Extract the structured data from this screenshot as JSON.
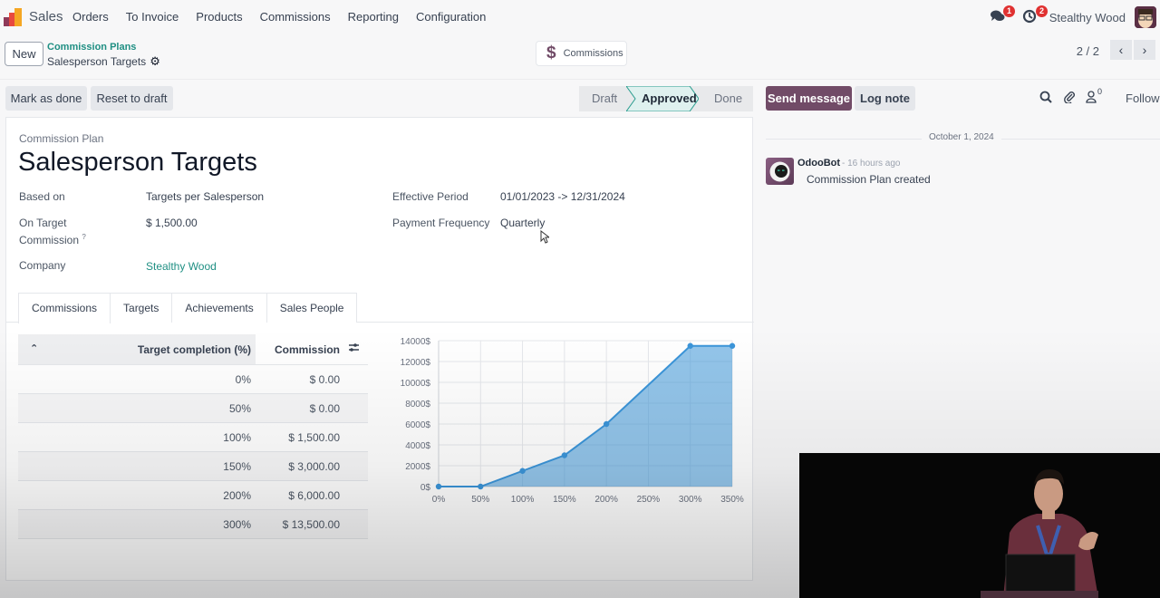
{
  "navbar": {
    "app_name": "Sales",
    "menu": [
      "Orders",
      "To Invoice",
      "Products",
      "Commissions",
      "Reporting",
      "Configuration"
    ],
    "messages_badge": "1",
    "activities_badge": "2",
    "user_name": "Stealthy Wood"
  },
  "control_panel": {
    "new_label": "New",
    "breadcrumb_parent": "Commission Plans",
    "breadcrumb_current": "Salesperson Targets",
    "smart_button_label": "Commissions",
    "pager": "2 / 2"
  },
  "statusbar": {
    "buttons": [
      "Mark as done",
      "Reset to draft"
    ],
    "stages": [
      "Draft",
      "Approved",
      "Done"
    ],
    "active_stage": "Approved"
  },
  "form": {
    "model_label": "Commission Plan",
    "title": "Salesperson Targets",
    "fields": {
      "based_on": {
        "label": "Based on",
        "value": "Targets per Salesperson"
      },
      "on_target_commission": {
        "label_line1": "On Target",
        "label_line2": "Commission",
        "help": "?",
        "value": "$ 1,500.00"
      },
      "company": {
        "label": "Company",
        "value": "Stealthy Wood"
      },
      "effective_period": {
        "label": "Effective Period",
        "value": "01/01/2023 -> 12/31/2024"
      },
      "payment_frequency": {
        "label": "Payment Frequency",
        "value": "Quarterly"
      }
    },
    "tabs": [
      "Commissions",
      "Targets",
      "Achievements",
      "Sales People"
    ],
    "active_tab": "Commissions"
  },
  "commission_table": {
    "headers": [
      "Target completion (%)",
      "Commission"
    ],
    "rows": [
      {
        "target": "0%",
        "commission": "$ 0.00"
      },
      {
        "target": "50%",
        "commission": "$ 0.00"
      },
      {
        "target": "100%",
        "commission": "$ 1,500.00"
      },
      {
        "target": "150%",
        "commission": "$ 3,000.00"
      },
      {
        "target": "200%",
        "commission": "$ 6,000.00"
      },
      {
        "target": "300%",
        "commission": "$ 13,500.00"
      }
    ]
  },
  "chart_data": {
    "type": "area",
    "title": "",
    "xlabel": "",
    "ylabel": "",
    "x_ticks": [
      "0%",
      "50%",
      "100%",
      "150%",
      "200%",
      "250%",
      "300%",
      "350%"
    ],
    "y_ticks": [
      "0$",
      "2000$",
      "4000$",
      "6000$",
      "8000$",
      "10000$",
      "12000$",
      "14000$"
    ],
    "xlim": [
      0,
      350
    ],
    "ylim": [
      0,
      14000
    ],
    "grid": true,
    "legend": "none",
    "series": [
      {
        "name": "Commission",
        "color": "#3b95d9",
        "x": [
          0,
          50,
          100,
          150,
          200,
          300,
          350
        ],
        "y": [
          0,
          0,
          1500,
          3000,
          6000,
          13500,
          13500
        ]
      }
    ]
  },
  "chatter": {
    "send_message": "Send message",
    "log_note": "Log note",
    "followers_count": "0",
    "follow": "Follow",
    "date": "October 1, 2024",
    "messages": [
      {
        "author": "OdooBot",
        "time": "- 16 hours ago",
        "body": "Commission Plan created"
      }
    ]
  },
  "colors": {
    "brand": "#714b67",
    "link": "#1f8f83",
    "badge": "#e03131",
    "chart_line": "#3b95d9"
  }
}
